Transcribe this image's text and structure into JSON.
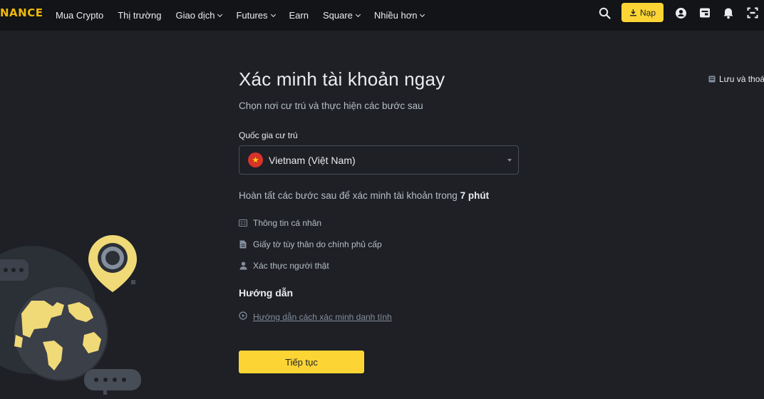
{
  "header": {
    "logo_text": "NANCE",
    "nav": [
      {
        "label": "Mua Crypto",
        "dropdown": false
      },
      {
        "label": "Thị trường",
        "dropdown": false
      },
      {
        "label": "Giao dịch",
        "dropdown": true
      },
      {
        "label": "Futures",
        "dropdown": true
      },
      {
        "label": "Earn",
        "dropdown": false
      },
      {
        "label": "Square",
        "dropdown": true
      },
      {
        "label": "Nhiều hơn",
        "dropdown": true
      }
    ],
    "deposit_label": "Nạp",
    "icons": [
      "search-icon",
      "download-icon",
      "user-icon",
      "wallet-icon",
      "bell-icon",
      "scan-icon"
    ]
  },
  "save_exit_label": "Lưu và thoá",
  "main": {
    "title": "Xác minh tài khoản ngay",
    "subtitle": "Chọn nơi cư trú và thực hiện các bước sau",
    "country_label": "Quốc gia cư trú",
    "country_value": "Vietnam (Việt Nam)",
    "steps_intro": "Hoàn tất các bước sau để xác minh tài khoản trong",
    "steps_time": "7 phút",
    "steps": [
      {
        "label": "Thông tin cá nhân",
        "icon": "id-card-icon"
      },
      {
        "label": "Giấy tờ tùy thân do chính phủ cấp",
        "icon": "document-icon"
      },
      {
        "label": "Xác thực người thật",
        "icon": "person-icon"
      }
    ],
    "guide_heading": "Hướng dẫn",
    "guide_link": "Hướng dẫn cách xác minh danh tính",
    "continue_label": "Tiếp tục"
  },
  "colors": {
    "background": "#1e2026",
    "topbar": "#121417",
    "accent": "#fcd535",
    "brand": "#f0b90b"
  }
}
